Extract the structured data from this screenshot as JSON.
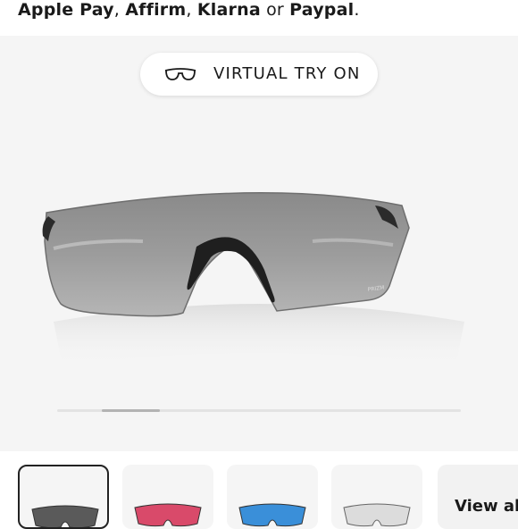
{
  "payment": {
    "apple_pay": "Apple Pay",
    "sep1": ", ",
    "affirm": "Affirm",
    "sep2": ", ",
    "klarna": "Klarna",
    "or": " or ",
    "paypal": "Paypal",
    "period": "."
  },
  "gallery": {
    "try_on_label": "VIRTUAL TRY ON",
    "try_on_icon": "glasses-outline-icon",
    "lens_brand_mark": "PRIZM",
    "carousel_position": 0.08
  },
  "thumbnails": {
    "variants": [
      {
        "name": "prizm-black",
        "selected": true,
        "lens_color": "#5a5a5a"
      },
      {
        "name": "prizm-road",
        "selected": false,
        "lens_color": "#d94a6a"
      },
      {
        "name": "prizm-sapphire",
        "selected": false,
        "lens_color": "#3a8fd9"
      },
      {
        "name": "clear",
        "selected": false,
        "lens_color": "#dcdcdc"
      }
    ],
    "view_all_label": "View all"
  }
}
